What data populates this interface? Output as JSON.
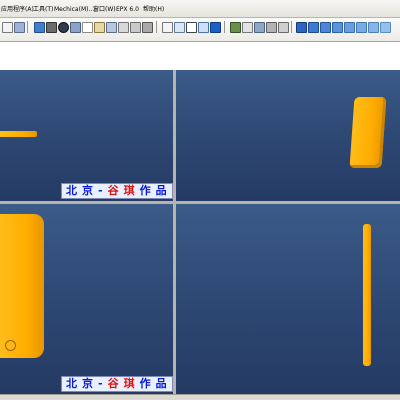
{
  "menubar": {
    "items": [
      "应用程序(A)",
      "工具(T)",
      "Mechica(M)...",
      "窗口(W)",
      "EPX 6.0",
      "帮助(H)"
    ]
  },
  "toolbar": {
    "icons": [
      "new-icon",
      "open-icon",
      "save-icon",
      "print-icon",
      "undo-icon",
      "redo-icon",
      "zoom-in-icon",
      "zoom-out-icon",
      "refit-icon",
      "orient-icon",
      "view-icon",
      "shade-icon",
      "wireframe-icon",
      "datum-plane-icon",
      "datum-axis-icon",
      "datum-point-icon",
      "coord-sys-icon",
      "sketch-icon"
    ]
  },
  "viewports": {
    "top_left": {
      "watermark": {
        "part1": "北京-",
        "part2": "谷琪",
        "part3": "作品"
      }
    },
    "top_right": {},
    "bottom_left": {
      "watermark": {
        "part1": "北京-",
        "part2": "谷琪",
        "part3": "作品"
      }
    },
    "bottom_right": {}
  },
  "colors": {
    "part": "#ffad00",
    "viewport_top": "#3b5b88",
    "viewport_bottom": "#243a63",
    "watermark_blue": "#0a1bd0",
    "watermark_red": "#e01313"
  }
}
